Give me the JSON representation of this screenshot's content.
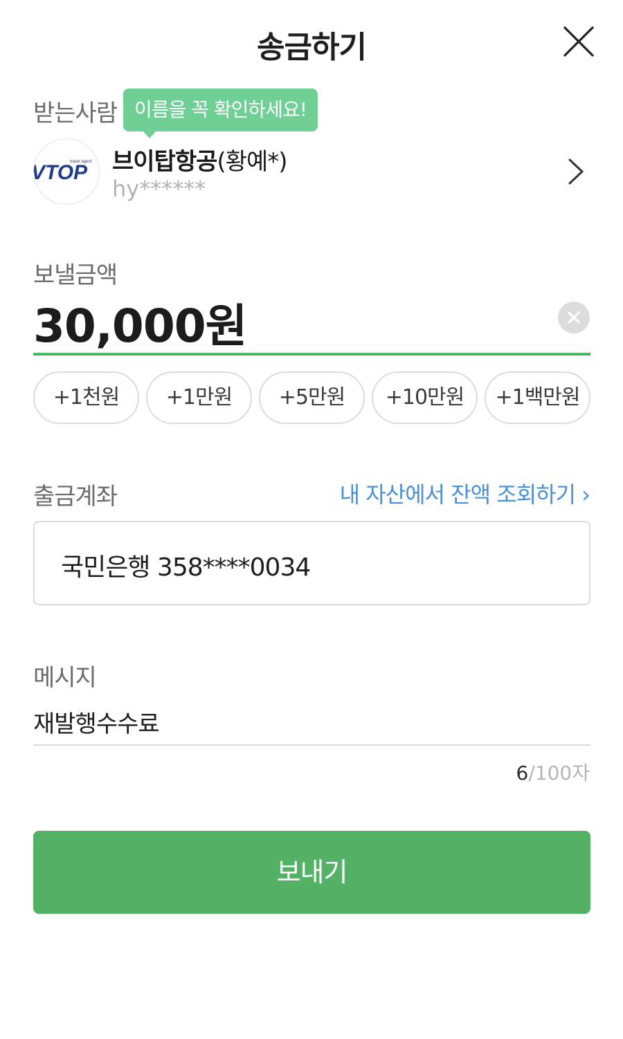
{
  "header": {
    "title": "송금하기",
    "close_icon": "close-icon"
  },
  "recipient": {
    "label": "받는사람",
    "tooltip": "이름을 꼭 확인하세요!",
    "name": "브이탑항공",
    "name_detail": "(황예*)",
    "id": "hy******",
    "avatar_logo_text": "VTOP travel agent"
  },
  "amount": {
    "label": "보낼금액",
    "value": "30,000원",
    "quick_add": [
      "+1천원",
      "+1만원",
      "+5만원",
      "+10만원",
      "+1백만원"
    ]
  },
  "account": {
    "label": "출금계좌",
    "balance_link": "내 자산에서 잔액 조회하기 ›",
    "value": "국민은행 358****0034"
  },
  "message": {
    "label": "메시지",
    "value": "재발행수수료",
    "count": "6",
    "max": "/100자"
  },
  "send_button": "보내기",
  "colors": {
    "accent": "#53b266",
    "tooltip": "#6fcf94",
    "link": "#4a90d9"
  }
}
